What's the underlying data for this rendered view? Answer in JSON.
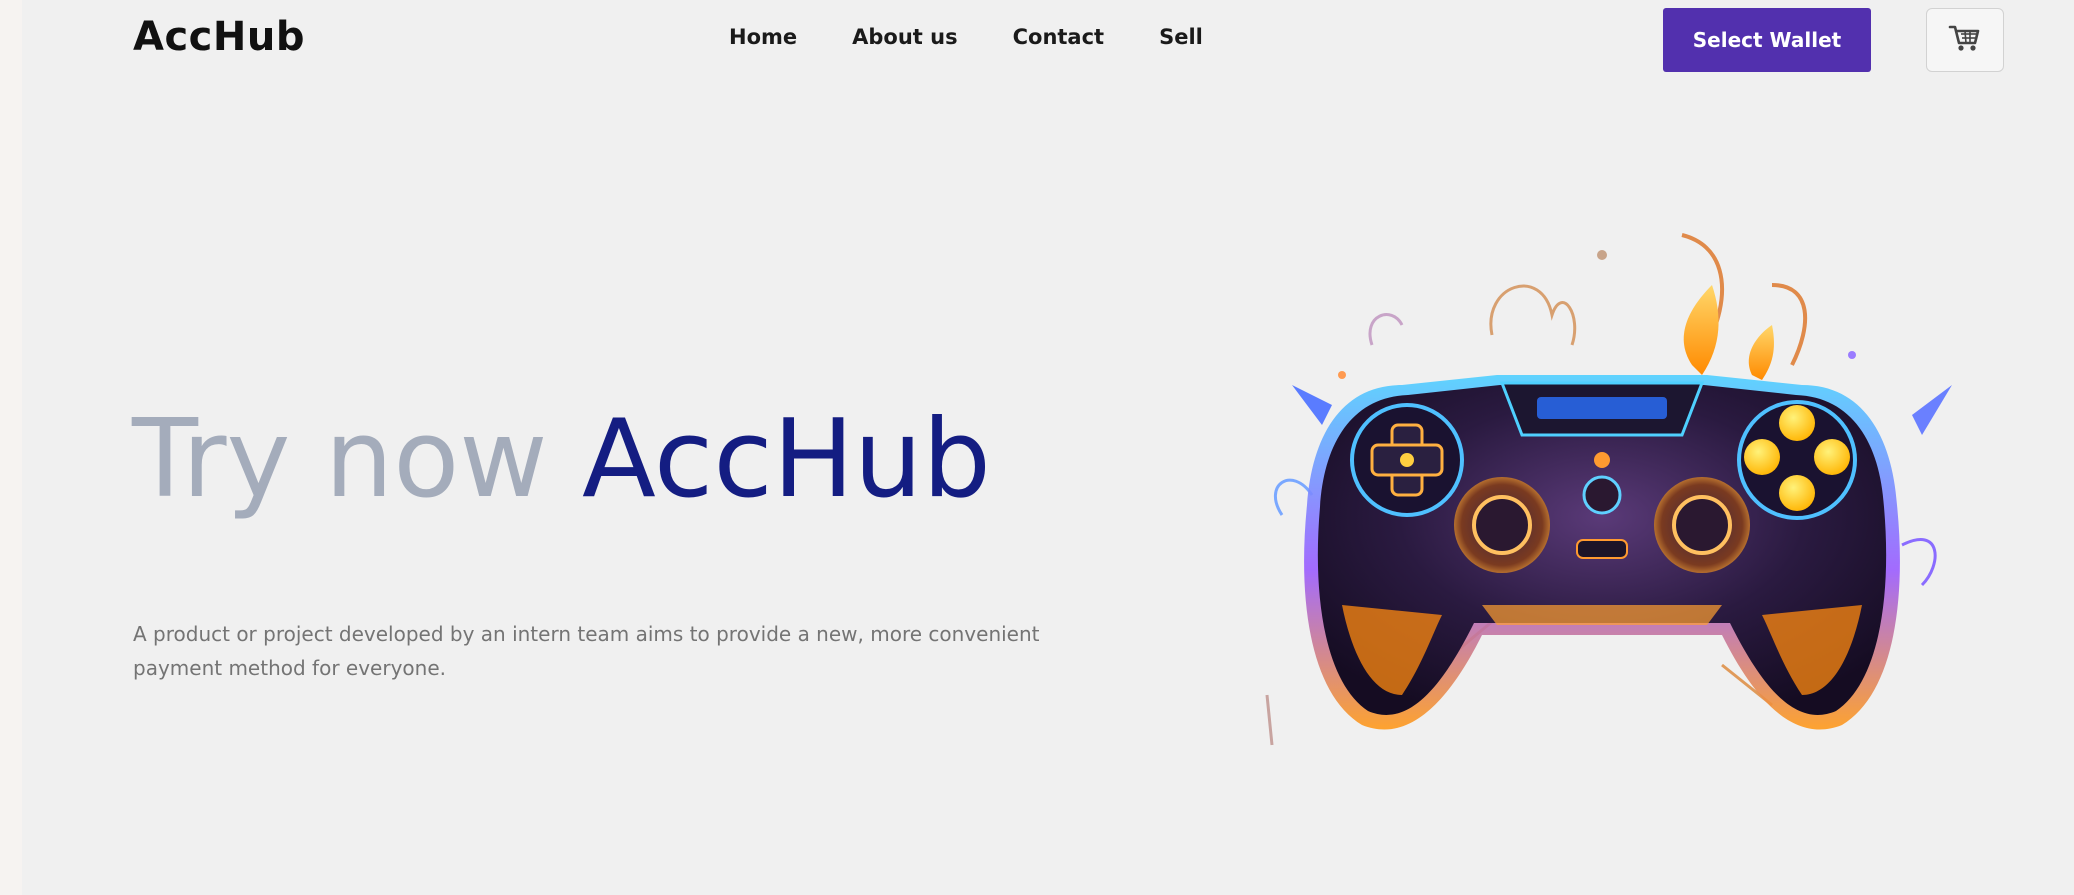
{
  "header": {
    "logo": "AccHub",
    "nav": [
      {
        "label": "Home"
      },
      {
        "label": "About us"
      },
      {
        "label": "Contact"
      },
      {
        "label": "Sell"
      }
    ],
    "wallet_button": "Select Wallet",
    "cart_icon": "cart-icon"
  },
  "hero": {
    "title_prefix": "Try now",
    "title_brand": "AccHub",
    "description": "A product or project developed by an intern team aims to provide a new, more convenient payment method for everyone.",
    "illustration": "gamepad-illustration"
  },
  "colors": {
    "accent": "#5230ae",
    "brand_title": "#141d82",
    "muted_title": "#a4acbb",
    "background": "#f0f0f0"
  }
}
